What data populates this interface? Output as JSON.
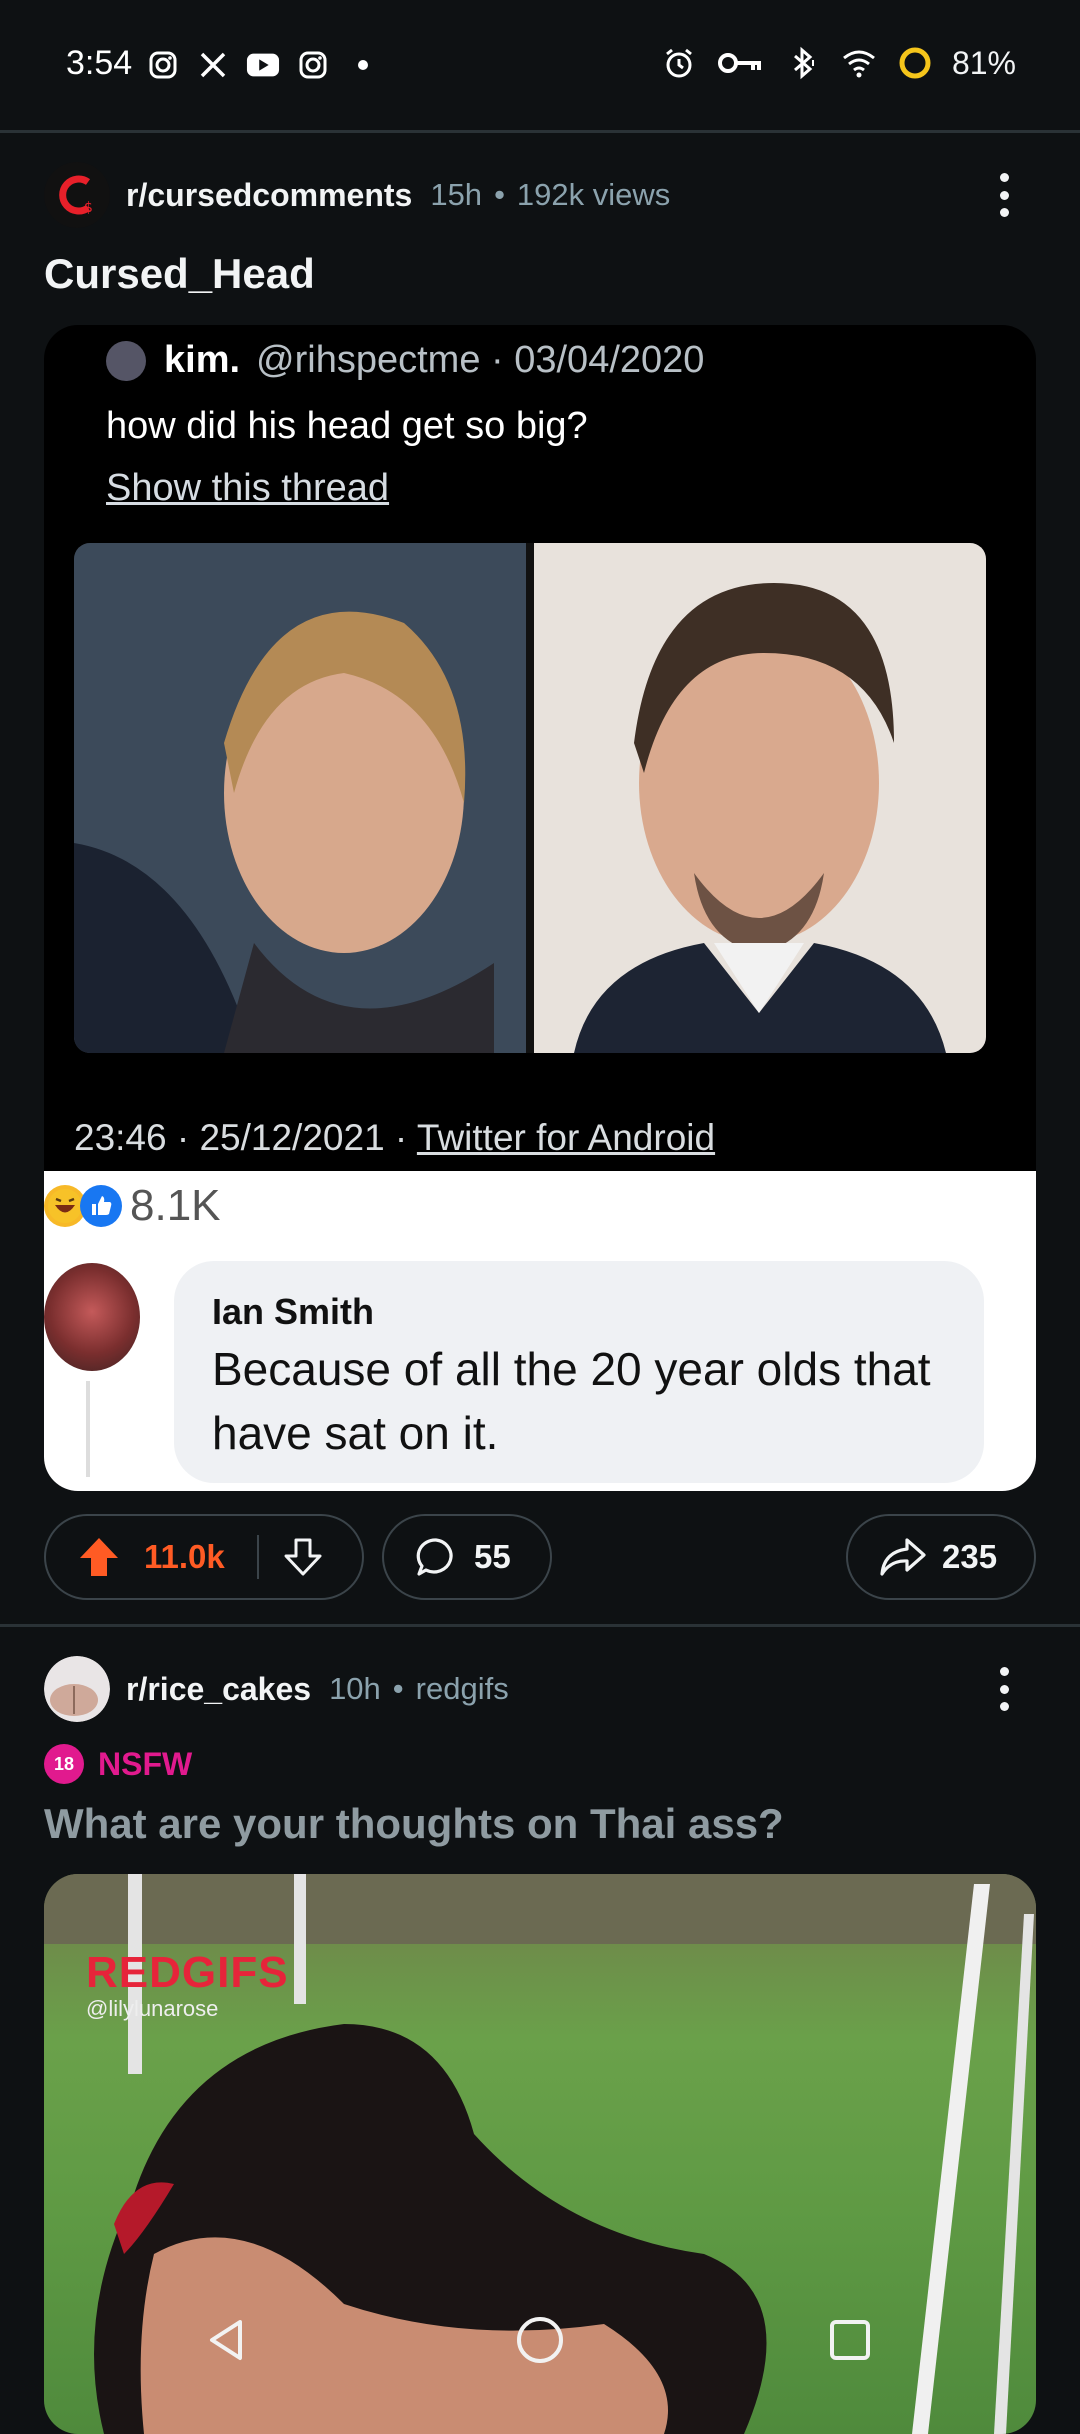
{
  "status_bar": {
    "time": "3:54",
    "left_icons": [
      "instagram-icon",
      "x-icon",
      "youtube-icon",
      "instagram-icon",
      "dot-icon"
    ],
    "right_icons": [
      "alarm-icon",
      "vpn-key-icon",
      "bluetooth-icon",
      "wifi-icon",
      "battery-icon"
    ],
    "battery": "81%"
  },
  "post1": {
    "subreddit": "r/cursedcomments",
    "age": "15h",
    "separator": "•",
    "views": "192k views",
    "title": "Cursed_Head",
    "tweet": {
      "author": "kim.",
      "handle_date": "@rihspectme · 03/04/2020",
      "text": "how did his head get so big?",
      "thread_link": "Show this thread",
      "timestamp": "23:46 · 25/12/2021 ·",
      "source": "Twitter for Android"
    },
    "facebook": {
      "reaction_count": "8.1K",
      "commenter": "Ian Smith",
      "comment": "Because of all the 20 year olds that have sat on it."
    },
    "score": "11.0k",
    "comments": "55",
    "shares": "235"
  },
  "post2": {
    "subreddit": "r/rice_cakes",
    "age": "10h",
    "separator": "•",
    "source": "redgifs",
    "nsfw_badge": "18",
    "nsfw_label": "NSFW",
    "title": "What are your thoughts on Thai ass?",
    "watermark": "REDGIFS",
    "watermark_user": "@lilylunarose"
  },
  "colors": {
    "background": "#0e1113",
    "upvote_accent": "#ff5b24",
    "nsfw": "#e11a8e",
    "meta_text": "#8ba2ad"
  }
}
